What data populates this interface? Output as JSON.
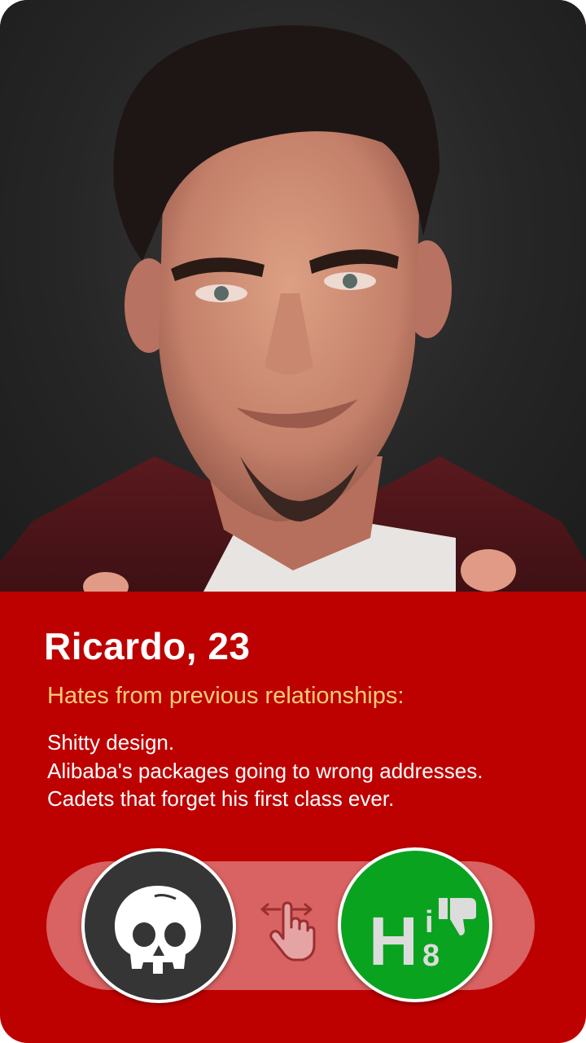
{
  "profile": {
    "name_age": "Ricardo, 23",
    "subtitle": "Hates from previous relationships:",
    "hates": [
      "Shitty design.",
      "Alibaba's packages going to wrong addresses.",
      "Cadets that forget his first class ever."
    ]
  },
  "actions": {
    "skip_icon": "skull-icon",
    "swipe_icon": "swipe-hand-icon",
    "hate_logo_text": "H8",
    "hate_logo_mark": "i",
    "hate_icon": "thumbs-down-icon"
  },
  "colors": {
    "card_background": "#bd0000",
    "subtitle": "#ffcc77",
    "track": "#d96262",
    "skip_button": "#353535",
    "hate_button": "#0aa31f"
  }
}
